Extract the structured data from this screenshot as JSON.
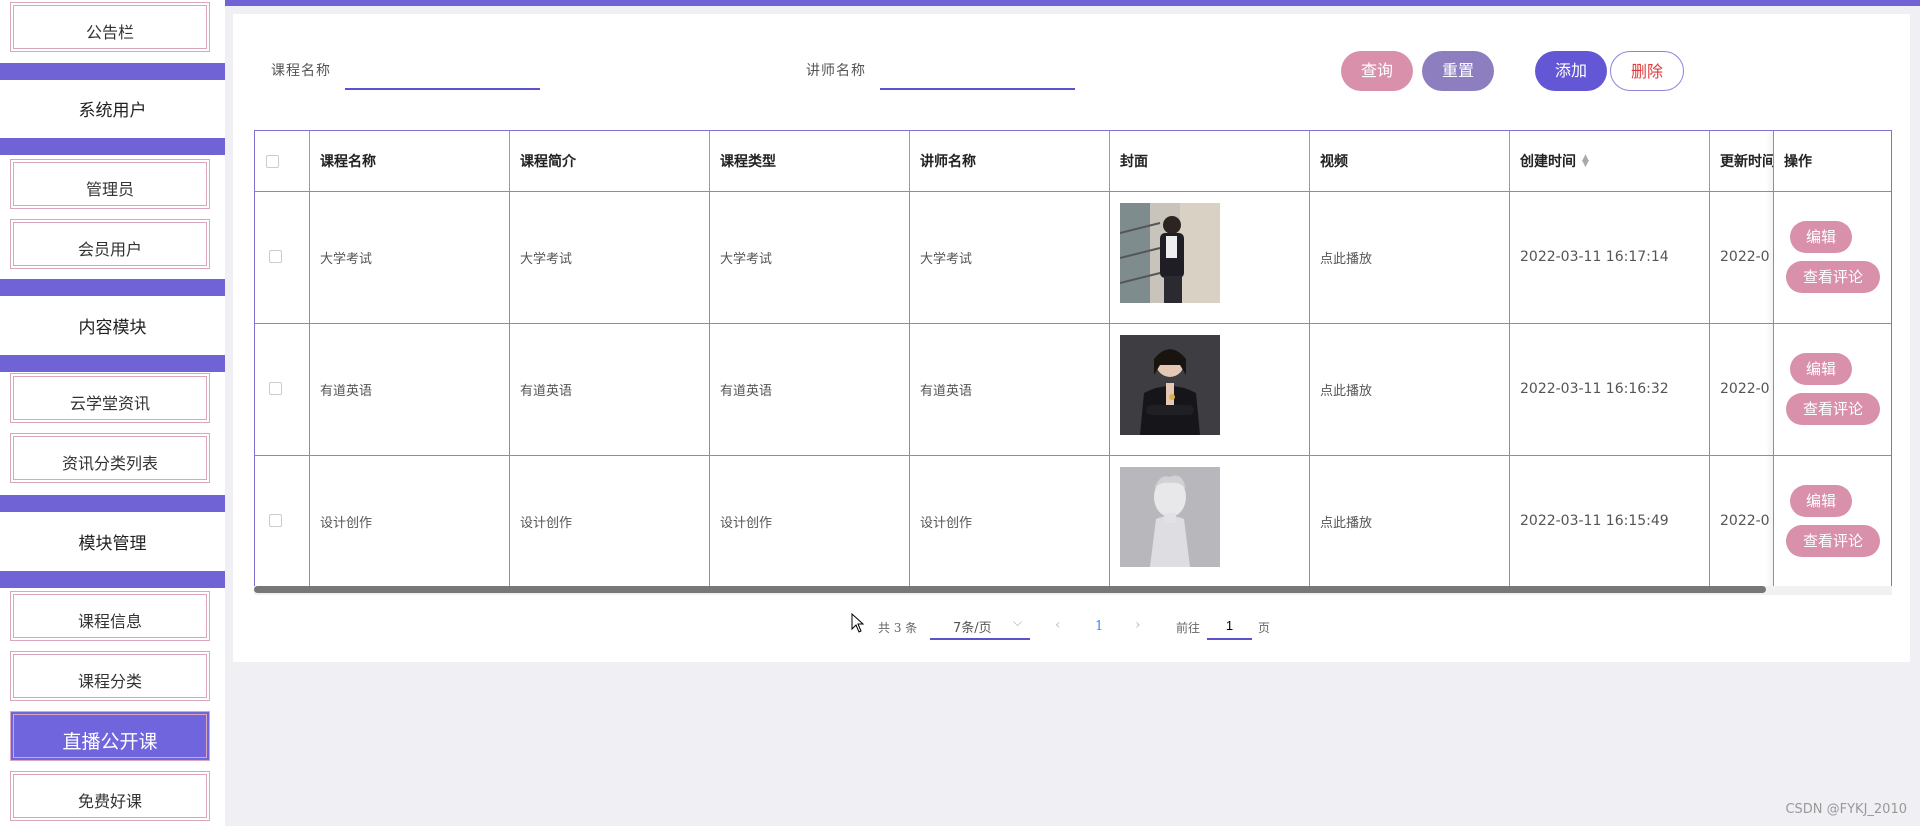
{
  "sidebar": {
    "items": [
      {
        "label": "公告栏"
      },
      {
        "label": "系统用户"
      },
      {
        "label": "管理员"
      },
      {
        "label": "会员用户"
      },
      {
        "label": "内容模块"
      },
      {
        "label": "云学堂资讯"
      },
      {
        "label": "资讯分类列表"
      },
      {
        "label": "模块管理"
      },
      {
        "label": "课程信息"
      },
      {
        "label": "课程分类"
      },
      {
        "label": "直播公开课"
      },
      {
        "label": "免费好课"
      }
    ],
    "active_item": "直播公开课",
    "accent_color": "#6f63d6"
  },
  "search": {
    "course_label": "课程名称",
    "course_value": "",
    "teacher_label": "讲师名称",
    "teacher_value": ""
  },
  "toolbar": {
    "query_label": "查询",
    "reset_label": "重置",
    "add_label": "添加",
    "delete_label": "删除"
  },
  "table": {
    "columns": [
      "课程名称",
      "课程简介",
      "课程类型",
      "讲师名称",
      "封面",
      "视频",
      "创建时间",
      "更新时间",
      "操作"
    ],
    "rows": [
      {
        "name": "大学考试",
        "intro": "大学考试",
        "type": "大学考试",
        "teacher": "大学考试",
        "cover": "woman-on-stairs-photo",
        "video": "点此播放",
        "created": "2022-03-11 16:17:14",
        "updated": "2022-0"
      },
      {
        "name": "有道英语",
        "intro": "有道英语",
        "type": "有道英语",
        "teacher": "有道英语",
        "cover": "woman-in-blazer-photo",
        "video": "点此播放",
        "created": "2022-03-11 16:16:32",
        "updated": "2022-0"
      },
      {
        "name": "设计创作",
        "intro": "设计创作",
        "type": "设计创作",
        "teacher": "设计创作",
        "cover": "plaster-statue-photo",
        "video": "点此播放",
        "created": "2022-03-11 16:15:49",
        "updated": "2022-0"
      }
    ],
    "edit_label": "编辑",
    "review_label": "查看评论"
  },
  "pagination": {
    "total_text": "共 3 条",
    "page_size": "7条/页",
    "current_page": "1",
    "goto_label": "前往",
    "goto_value": "1",
    "page_suffix": "页"
  },
  "watermark": "CSDN @FYKJ_2010"
}
